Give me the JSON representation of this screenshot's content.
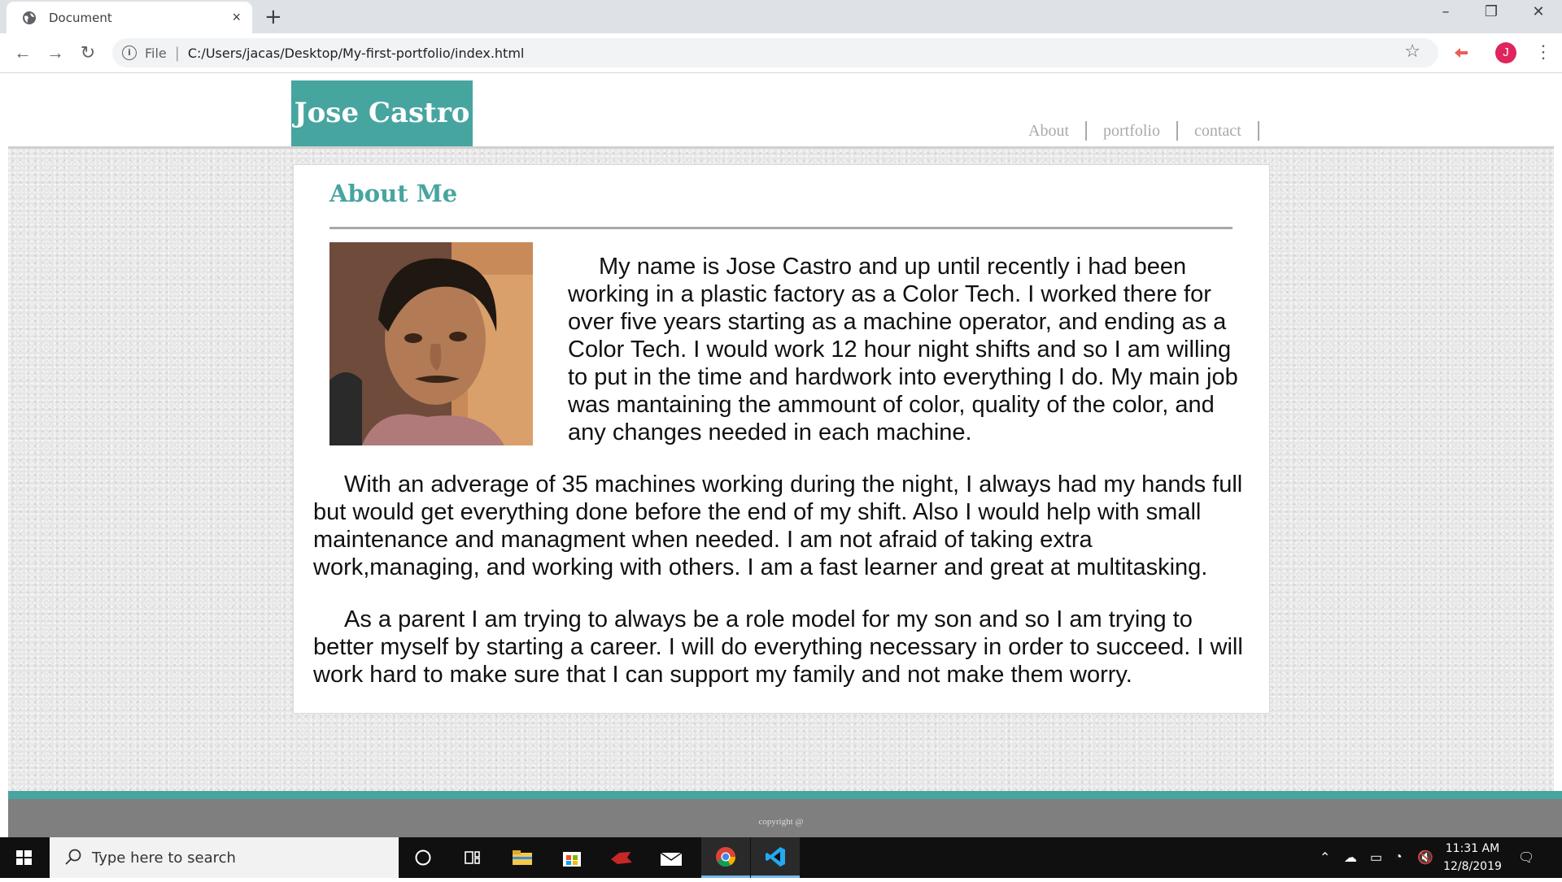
{
  "browser": {
    "tab_title": "Document",
    "tab_close": "×",
    "new_tab": "+",
    "window_controls": [
      "–",
      "❐",
      "✕"
    ],
    "url_scheme": "File",
    "url_separator": "|",
    "url_path": "C:/Users/jacas/Desktop/My-first-portfolio/index.html",
    "avatar_letter": "J",
    "nav_buttons": [
      "←",
      "→",
      "↻"
    ]
  },
  "site": {
    "logo": "Jose Castro",
    "nav": [
      "About",
      "portfolio",
      "contact"
    ],
    "section_title": "About Me",
    "paragraphs": [
      "My name is Jose Castro and up until recently i had been working in a plastic factory as a Color Tech. I worked there for over five years starting as a machine operator, and ending as a Color Tech. I would work 12 hour night shifts and so I am willing to put in the time and hardwork into everything I do. My main job was mantaining the ammount of color, quality of the color, and any changes needed in each machine.",
      "With an adverage of 35 machines working during the night, I always had my hands full but would get everything done before the end of my shift. Also I would help with small maintenance and managment when needed. I am not afraid of taking extra work,managing, and working with others. I am a fast learner and great at multitasking.",
      "As a parent I am trying to always be a role model for my son and so I am trying to better myself by starting a career. I will do everything necessary in order to succeed. I will work hard to make sure that I can support my family and not make them worry."
    ],
    "footer": "copyright @"
  },
  "taskbar": {
    "search_placeholder": "Type here to search",
    "time": "11:31 AM",
    "date": "12/8/2019"
  },
  "colors": {
    "accent": "#47a5a0",
    "footer": "#7f7f7f",
    "nav_text": "#a9a9a9"
  }
}
